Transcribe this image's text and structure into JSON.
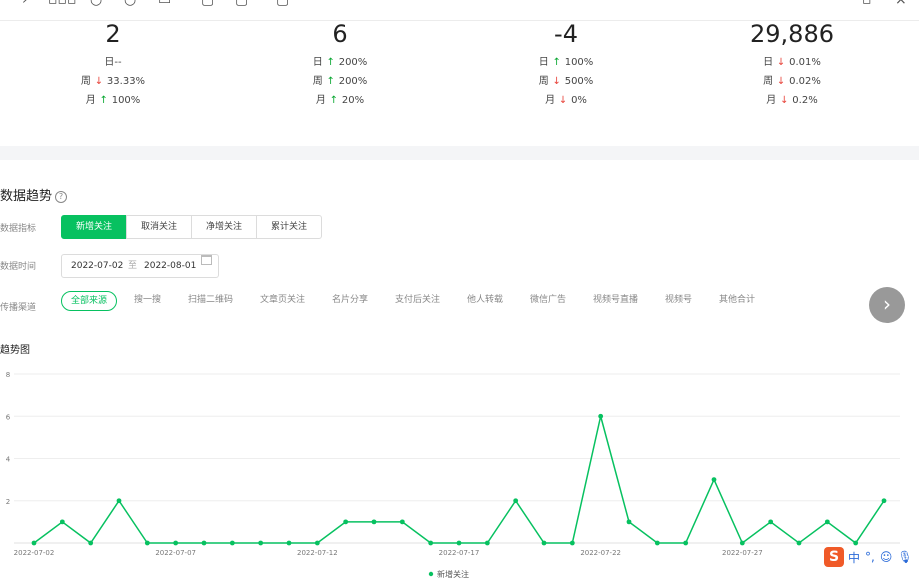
{
  "stats": [
    {
      "value": "2",
      "rows": [
        {
          "label": "日",
          "dir": "none",
          "value": "--"
        },
        {
          "label": "周",
          "dir": "down",
          "value": "33.33%"
        },
        {
          "label": "月",
          "dir": "up",
          "value": "100%"
        }
      ]
    },
    {
      "value": "6",
      "rows": [
        {
          "label": "日",
          "dir": "up",
          "value": "200%"
        },
        {
          "label": "周",
          "dir": "up",
          "value": "200%"
        },
        {
          "label": "月",
          "dir": "up",
          "value": "20%"
        }
      ]
    },
    {
      "value": "-4",
      "rows": [
        {
          "label": "日",
          "dir": "up",
          "value": "100%"
        },
        {
          "label": "周",
          "dir": "down",
          "value": "500%"
        },
        {
          "label": "月",
          "dir": "down",
          "value": "0%"
        }
      ]
    },
    {
      "value": "29,886",
      "rows": [
        {
          "label": "日",
          "dir": "down",
          "value": "0.01%"
        },
        {
          "label": "周",
          "dir": "down",
          "value": "0.02%"
        },
        {
          "label": "月",
          "dir": "down",
          "value": "0.2%"
        }
      ]
    }
  ],
  "section": {
    "title": "数据趋势",
    "help": "?"
  },
  "labels": {
    "metric": "数据指标",
    "time": "数据时间",
    "channel": "传播渠道"
  },
  "metrics": {
    "selected": "新增关注",
    "items": [
      "新增关注",
      "取消关注",
      "净增关注",
      "累计关注"
    ]
  },
  "date_range": {
    "start": "2022-07-02",
    "sep": "至",
    "end": "2022-08-01"
  },
  "channels": {
    "selected": "全部来源",
    "items": [
      "全部来源",
      "搜一搜",
      "扫描二维码",
      "文章页关注",
      "名片分享",
      "支付后关注",
      "他人转载",
      "微信广告",
      "视频号直播",
      "视频号",
      "其他合计"
    ]
  },
  "next_icon": "chevron-right-icon",
  "chart_title": "趋势图",
  "ime": {
    "logo": "S",
    "lang": "中",
    "punct": "°,",
    "emoji": "☺",
    "mic": "mic-icon"
  },
  "colors": {
    "accent": "#07c160",
    "up": "#07a62f",
    "down": "#e8453c"
  },
  "chart_data": {
    "type": "line",
    "x": [
      "2022-07-02",
      "2022-07-03",
      "2022-07-04",
      "2022-07-05",
      "2022-07-06",
      "2022-07-07",
      "2022-07-08",
      "2022-07-09",
      "2022-07-10",
      "2022-07-11",
      "2022-07-12",
      "2022-07-13",
      "2022-07-14",
      "2022-07-15",
      "2022-07-16",
      "2022-07-17",
      "2022-07-18",
      "2022-07-19",
      "2022-07-20",
      "2022-07-21",
      "2022-07-22",
      "2022-07-23",
      "2022-07-24",
      "2022-07-25",
      "2022-07-26",
      "2022-07-27",
      "2022-07-28",
      "2022-07-29",
      "2022-07-30",
      "2022-07-31",
      "2022-08-01"
    ],
    "xticks": [
      "2022-07-02",
      "2022-07-07",
      "2022-07-12",
      "2022-07-17",
      "2022-07-22",
      "2022-07-27"
    ],
    "series": [
      {
        "name": "新增关注",
        "values": [
          0,
          1,
          0,
          2,
          0,
          0,
          0,
          0,
          0,
          0,
          0,
          1,
          1,
          1,
          0,
          0,
          0,
          2,
          0,
          0,
          6,
          1,
          0,
          0,
          3,
          0,
          1,
          0,
          1,
          0,
          2
        ]
      }
    ],
    "ylim": [
      0,
      8
    ],
    "yticks": [
      2,
      4,
      6,
      8
    ],
    "grid": true,
    "legend": "bottom",
    "color": "#07c160"
  }
}
